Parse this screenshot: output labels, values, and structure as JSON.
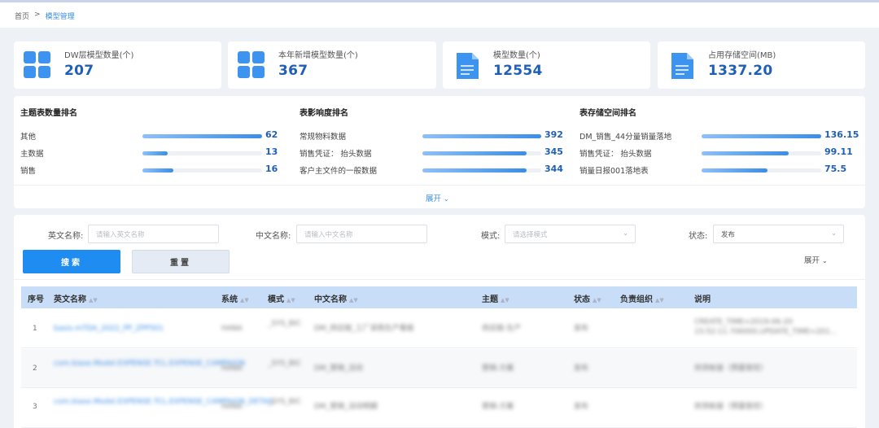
{
  "breadcrumb": {
    "home": "首页",
    "separator": ">",
    "current": "模型管理"
  },
  "stats": [
    {
      "label": "DW层模型数量(个)",
      "value": "207",
      "icon": "grid-icon"
    },
    {
      "label": "本年新增模型数量(个)",
      "value": "367",
      "icon": "grid-icon"
    },
    {
      "label": "模型数量(个)",
      "value": "12554",
      "icon": "document-icon"
    },
    {
      "label": "占用存储空间(MB)",
      "value": "1337.20",
      "icon": "document-icon"
    }
  ],
  "rankings": [
    {
      "title": "主题表数量排名",
      "items": [
        {
          "name": "其他",
          "value": "62",
          "ratio": 1.0
        },
        {
          "name": "主数据",
          "value": "13",
          "ratio": 0.21
        },
        {
          "name": "销售",
          "value": "16",
          "ratio": 0.26
        }
      ]
    },
    {
      "title": "表影响度排名",
      "items": [
        {
          "name": "常规物料数据",
          "value": "392",
          "ratio": 1.0
        },
        {
          "name": "销售凭证： 抬头数据",
          "value": "345",
          "ratio": 0.88
        },
        {
          "name": "客户主文件的一般数据",
          "value": "344",
          "ratio": 0.88
        }
      ]
    },
    {
      "title": "表存储空间排名",
      "items": [
        {
          "name": "DM_销售_44分量销量落地",
          "value": "136.15",
          "ratio": 1.0
        },
        {
          "name": "销售凭证： 抬头数据",
          "value": "99.11",
          "ratio": 0.73
        },
        {
          "name": "销量日报001落地表",
          "value": "75.5",
          "ratio": 0.55
        }
      ]
    }
  ],
  "expand_label": "展开",
  "filters": {
    "english_name": {
      "label": "英文名称:",
      "placeholder": "请输入英文名称"
    },
    "chinese_name": {
      "label": "中文名称:",
      "placeholder": "请输入中文名称"
    },
    "mode": {
      "label": "模式:",
      "placeholder": "请选择模式"
    },
    "status": {
      "label": "状态:",
      "value": "发布"
    },
    "search_label": "搜索",
    "reset_label": "重置",
    "more_label": "展开"
  },
  "table": {
    "columns": [
      "序号",
      "英文名称",
      "系统",
      "模式",
      "中文名称",
      "主题",
      "状态",
      "负责组织",
      "说明"
    ],
    "rows": [
      {
        "index": "1",
        "english": "basis-mTDA_2022_PP_ZPP501",
        "system": "HANA",
        "mode": "_SYS_BIC",
        "chinese": "DM_供应链_工厂采购生产看板",
        "theme": "供应链-生产",
        "status": "发布",
        "org": "",
        "desc": "CREATE_TIME=2019-06-20 15:52:11.706000,UPDATE_TIME=201..."
      },
      {
        "index": "2",
        "english": "com.biase.Model.EXPENSE.TCL.EXPENSE_CAMPAIGN",
        "system": "HANA",
        "mode": "_SYS_BIC",
        "chinese": "DM_营销_活动",
        "theme": "营销-方案",
        "status": "发布",
        "org": "",
        "desc": "供货帐接（预量管控）"
      },
      {
        "index": "3",
        "english": "com.biase.Model.EXPENSE.TCL.EXPENSE_CAMPAIGN_DETAIL",
        "system": "HANA",
        "mode": "_SYS_BIC",
        "chinese": "DM_营销_活动明细",
        "theme": "营销-方案",
        "status": "发布",
        "org": "",
        "desc": "供货帐接（预量管控）"
      }
    ]
  }
}
